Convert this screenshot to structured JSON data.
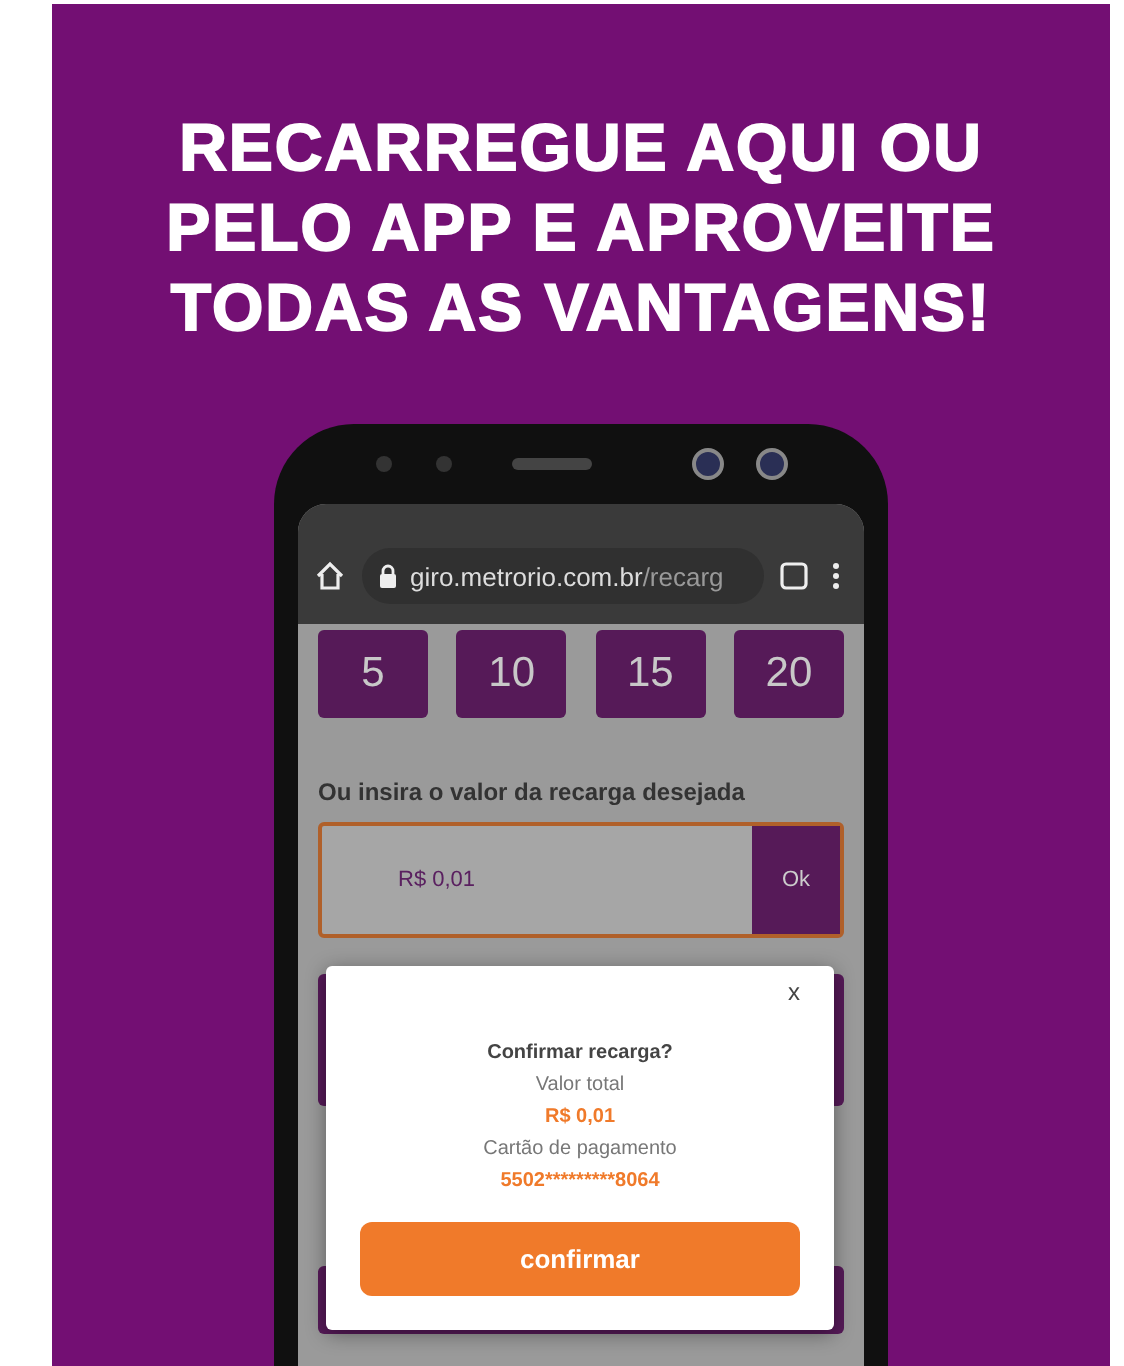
{
  "headline": [
    "RECARREGUE AQUI OU",
    "PELO APP E APROVEITE",
    "TODAS AS VANTAGENS!"
  ],
  "browser": {
    "url_host": "giro.metrorio.com.br",
    "url_path": "/recarg"
  },
  "amounts": [
    "5",
    "10",
    "15",
    "20"
  ],
  "custom_amount": {
    "label": "Ou insira o valor da recarga desejada",
    "value": "R$ 0,01",
    "button": "Ok"
  },
  "dialog": {
    "close": "x",
    "title": "Confirmar recarga?",
    "total_label": "Valor total",
    "total": "R$ 0,01",
    "card_label": "Cartão de pagamento",
    "card": "5502*********8064",
    "button": "confirmar"
  }
}
